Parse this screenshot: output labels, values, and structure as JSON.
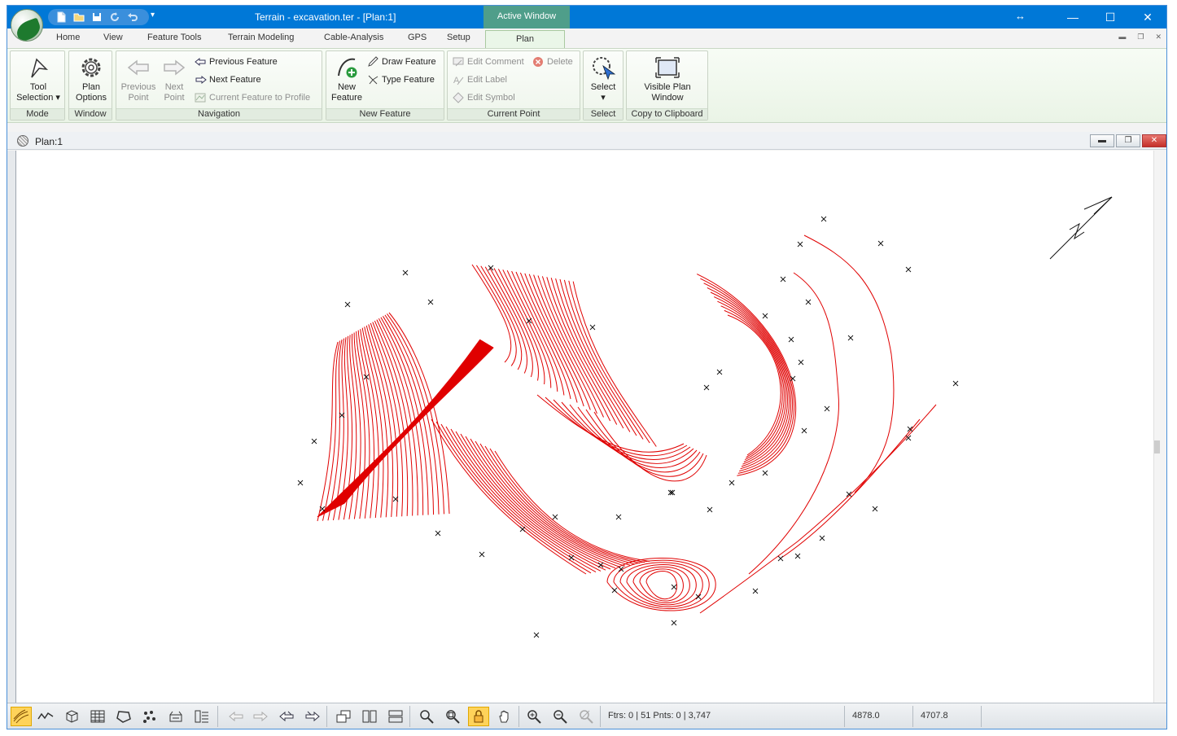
{
  "titlebar": {
    "title": "Terrain - excavation.ter - [Plan:1]",
    "active_window_label": "Active Window"
  },
  "tabs": [
    {
      "label": "Home"
    },
    {
      "label": "View"
    },
    {
      "label": "Feature Tools"
    },
    {
      "label": "Terrain Modeling"
    },
    {
      "label": "Cable-Analysis"
    },
    {
      "label": "GPS"
    },
    {
      "label": "Setup"
    },
    {
      "label": "Plan",
      "selected": true
    }
  ],
  "ribbon": {
    "mode": {
      "label": "Mode",
      "tool_selection": "Tool Selection",
      "tool_selection_line1": "Tool",
      "tool_selection_line2": "Selection"
    },
    "window": {
      "label": "Window",
      "plan_options_line1": "Plan",
      "plan_options_line2": "Options"
    },
    "navigation": {
      "label": "Navigation",
      "previous_point_line1": "Previous",
      "previous_point_line2": "Point",
      "next_point_line1": "Next",
      "next_point_line2": "Point",
      "previous_feature": "Previous Feature",
      "next_feature": "Next Feature",
      "current_feature_to_profile": "Current Feature to Profile"
    },
    "new_feature": {
      "label": "New Feature",
      "new_feature_line1": "New",
      "new_feature_line2": "Feature",
      "draw_feature": "Draw Feature",
      "type_feature": "Type Feature"
    },
    "current_point": {
      "label": "Current Point",
      "edit_comment": "Edit Comment",
      "delete": "Delete",
      "edit_label": "Edit Label",
      "edit_symbol": "Edit Symbol"
    },
    "select": {
      "label": "Select",
      "select_btn": "Select"
    },
    "clipboard": {
      "label": "Copy to Clipboard",
      "visible_plan_line1": "Visible Plan",
      "visible_plan_line2": "Window"
    }
  },
  "document": {
    "title": "Plan:1"
  },
  "statusbar": {
    "counts": "Ftrs: 0 | 51   Pnts: 0 | 3,747",
    "coord_x": "4878.0",
    "coord_y": "4707.8"
  },
  "colors": {
    "titlebar": "#0078d7",
    "contour": "#e00000",
    "active_tab": "#eaf6e8"
  }
}
